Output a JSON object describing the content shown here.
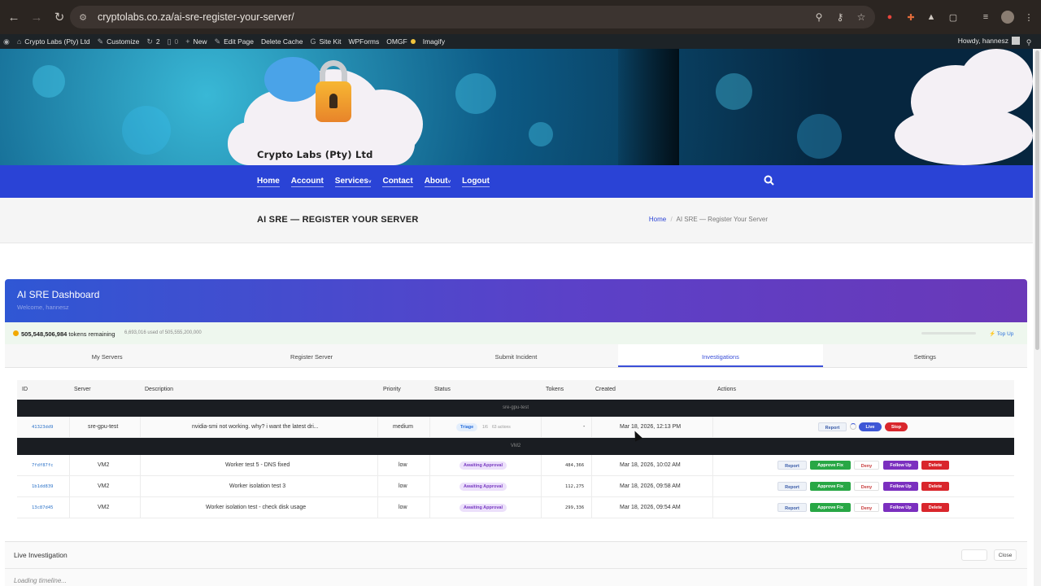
{
  "browser": {
    "url": "cryptolabs.co.za/ai-sre-register-your-server/"
  },
  "wp_admin": {
    "site_name": "Crypto Labs (Pty) Ltd",
    "customize": "Customize",
    "updates_count": "2",
    "comments_count": "0",
    "new": "New",
    "edit_page": "Edit Page",
    "delete_cache": "Delete Cache",
    "site_kit": "Site Kit",
    "wpforms": "WPForms",
    "omgf": "OMGF",
    "imagify": "Imagify",
    "howdy": "Howdy, hannesz"
  },
  "site": {
    "brand_name": "Crypto Labs (Pty) Ltd",
    "menu": [
      "Home",
      "Account",
      "Services",
      "Contact",
      "About",
      "Logout"
    ]
  },
  "page": {
    "title": "AI SRE — REGISTER YOUR SERVER",
    "breadcrumb_home": "Home",
    "breadcrumb_current": "AI SRE — Register Your Server"
  },
  "dashboard": {
    "title": "AI SRE Dashboard",
    "welcome": "Welcome, hannesz",
    "tokens_amount": "505,548,506,984",
    "tokens_label": "tokens remaining",
    "tokens_used": "6,693,016 used of 505,555,200,000",
    "top_up": "Top Up",
    "tabs": [
      "My Servers",
      "Register Server",
      "Submit Incident",
      "Investigations",
      "Settings"
    ],
    "active_tab": "Investigations"
  },
  "table": {
    "headers": {
      "id": "ID",
      "server": "Server",
      "description": "Description",
      "priority": "Priority",
      "status": "Status",
      "tokens": "Tokens",
      "created": "Created",
      "actions": "Actions"
    },
    "groups": [
      {
        "name": "sre-gpu-test",
        "rows": [
          {
            "id": "41323dd9",
            "server": "sre-gpu-test",
            "description": "nvidia-smi not working. why? i want the latest dri...",
            "priority": "medium",
            "status": "Triage",
            "progress": "1/6",
            "actions_count": "63 actions",
            "tokens": "-",
            "created": "Mar 18, 2026, 12:13 PM",
            "buttons": [
              "Report",
              "Live",
              "Stop"
            ]
          }
        ]
      },
      {
        "name": "VM2",
        "rows": [
          {
            "id": "7fdf87fc",
            "server": "VM2",
            "description": "Worker test 5 - DNS fixed",
            "priority": "low",
            "status": "Awaiting Approval",
            "tokens": "484,366",
            "created": "Mar 18, 2026, 10:02 AM",
            "buttons": [
              "Report",
              "Approve Fix",
              "Deny",
              "Follow Up",
              "Delete"
            ]
          },
          {
            "id": "1b1dd839",
            "server": "VM2",
            "description": "Worker isolation test 3",
            "priority": "low",
            "status": "Awaiting Approval",
            "tokens": "112,275",
            "created": "Mar 18, 2026, 09:58 AM",
            "buttons": [
              "Report",
              "Approve Fix",
              "Deny",
              "Follow Up",
              "Delete"
            ]
          },
          {
            "id": "13c87d45",
            "server": "VM2",
            "description": "Worker isolation test - check disk usage",
            "priority": "low",
            "status": "Awaiting Approval",
            "tokens": "299,336",
            "created": "Mar 18, 2026, 09:54 AM",
            "buttons": [
              "Report",
              "Approve Fix",
              "Deny",
              "Follow Up",
              "Delete"
            ]
          }
        ]
      }
    ]
  },
  "live_panel": {
    "title": "Live Investigation",
    "close": "Close",
    "loading": "Loading timeline..."
  },
  "colors": {
    "nav_blue": "#2a43d6",
    "header_gradient_start": "#2f57d4",
    "header_gradient_end": "#6a38b8",
    "approve_green": "#28a745",
    "follow_purple": "#7b2fbf",
    "delete_red": "#d9262c"
  }
}
